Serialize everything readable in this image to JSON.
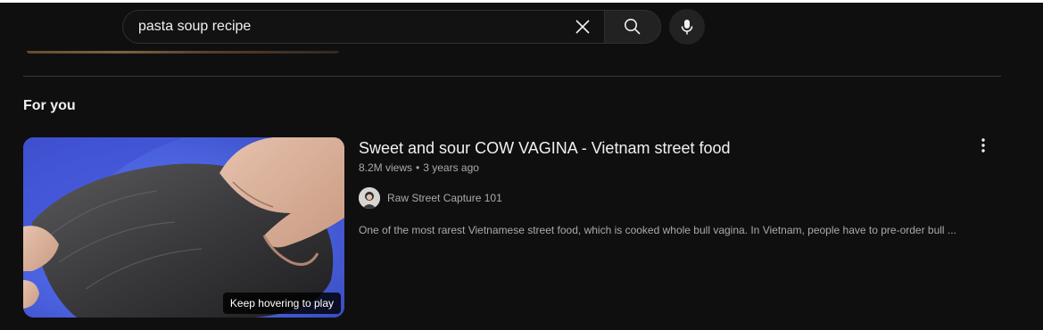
{
  "search": {
    "query": "pasta soup recipe",
    "clear_icon": "close-icon",
    "search_icon": "search-icon",
    "mic_icon": "microphone-icon"
  },
  "feed": {
    "section_title": "For you",
    "video": {
      "title": "Sweet and sour COW VAGINA - Vietnam street food",
      "views": "8.2M views",
      "age": "3 years ago",
      "channel": "Raw Street Capture 101",
      "description": "One of the most rarest Vietnamese street food, which is cooked whole bull vagina. In Vietnam, people have to pre-order bull ...",
      "hover_hint": "Keep hovering to play",
      "menu_icon": "more-vert-icon"
    }
  },
  "colors": {
    "background": "#0f0f0f",
    "search_field": "#121212",
    "button_bg": "#222222",
    "text_primary": "#f1f1f1",
    "text_secondary": "#aaaaaa"
  }
}
